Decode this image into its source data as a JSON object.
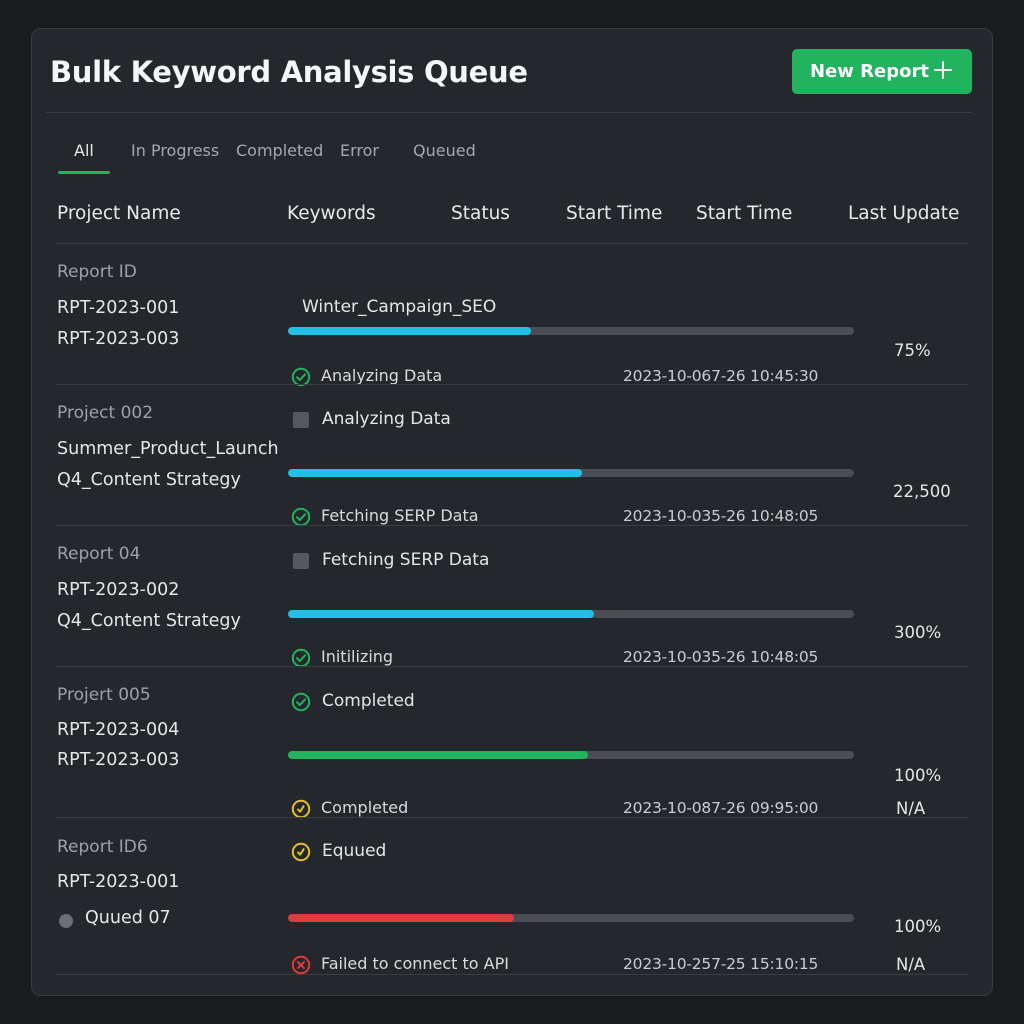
{
  "header": {
    "title": "Bulk Keyword Analysis Queue",
    "new_report_label": "New Report"
  },
  "tabs": [
    "All",
    "In Progress",
    "Completed",
    "Error",
    "Queued"
  ],
  "active_tab": "All",
  "columns": [
    "Project Name",
    "Keywords",
    "Status",
    "Start Time",
    "Start Time",
    "Last Update"
  ],
  "colors": {
    "accent": "#22b35e",
    "progress_cyan": "#1fc2e6",
    "progress_green": "#22b35e",
    "progress_red": "#e0393e",
    "status_yellow": "#e6c02a",
    "status_red": "#e0393e"
  },
  "rows": [
    {
      "id_label": "Report ID",
      "line1": "RPT-2023-001",
      "line2": "RPT-2023-003",
      "top_label": "Winter_Campaign_SEO",
      "top_icon": "none",
      "progress": 0.43,
      "progress_color": "cyan",
      "status_icon": "check-circle-icon",
      "status_text": "Analyzing Data",
      "timestamp": "2023-10-067-26 10:45:30",
      "value": "75%",
      "value2": ""
    },
    {
      "id_label": "Project 002",
      "line1": "Summer_Product_Launch",
      "line2": "Q4_Content Strategy",
      "top_label": "Analyzing Data",
      "top_icon": "square-icon",
      "progress": 0.52,
      "progress_color": "cyan",
      "status_icon": "check-circle-icon",
      "status_text": "Fetching SERP Data",
      "timestamp": "2023-10-035-26 10:48:05",
      "value": "22,500",
      "value2": ""
    },
    {
      "id_label": "Report 04",
      "line1": "RPT-2023-002",
      "line2": "Q4_Content Strategy",
      "top_label": "Fetching SERP Data",
      "top_icon": "square-icon",
      "progress": 0.54,
      "progress_color": "cyan",
      "status_icon": "check-circle-icon",
      "status_text": "Initilizing",
      "timestamp": "2023-10-035-26 10:48:05",
      "value": "300%",
      "value2": ""
    },
    {
      "id_label": "Projert 005",
      "line1": "RPT-2023-004",
      "line2": "RPT-2023-003",
      "top_label": "Completed",
      "top_icon": "check-circle-icon",
      "progress": 0.53,
      "progress_color": "green",
      "status_icon": "clock-circle-icon",
      "status_text": "Completed",
      "timestamp": "2023-10-087-26 09:95:00",
      "value": "100%",
      "value2": "N/A"
    },
    {
      "id_label": "Report ID6",
      "line1": "RPT-2023-001",
      "line2": "Quued 07",
      "top_label": "Equued",
      "top_icon": "clock-circle-icon",
      "progress": 0.4,
      "progress_color": "red",
      "status_icon": "error-circle-icon",
      "status_text": "Failed to connect to API",
      "timestamp": "2023-10-257-25 15:10:15",
      "value": "100%",
      "value2": "N/A"
    }
  ]
}
